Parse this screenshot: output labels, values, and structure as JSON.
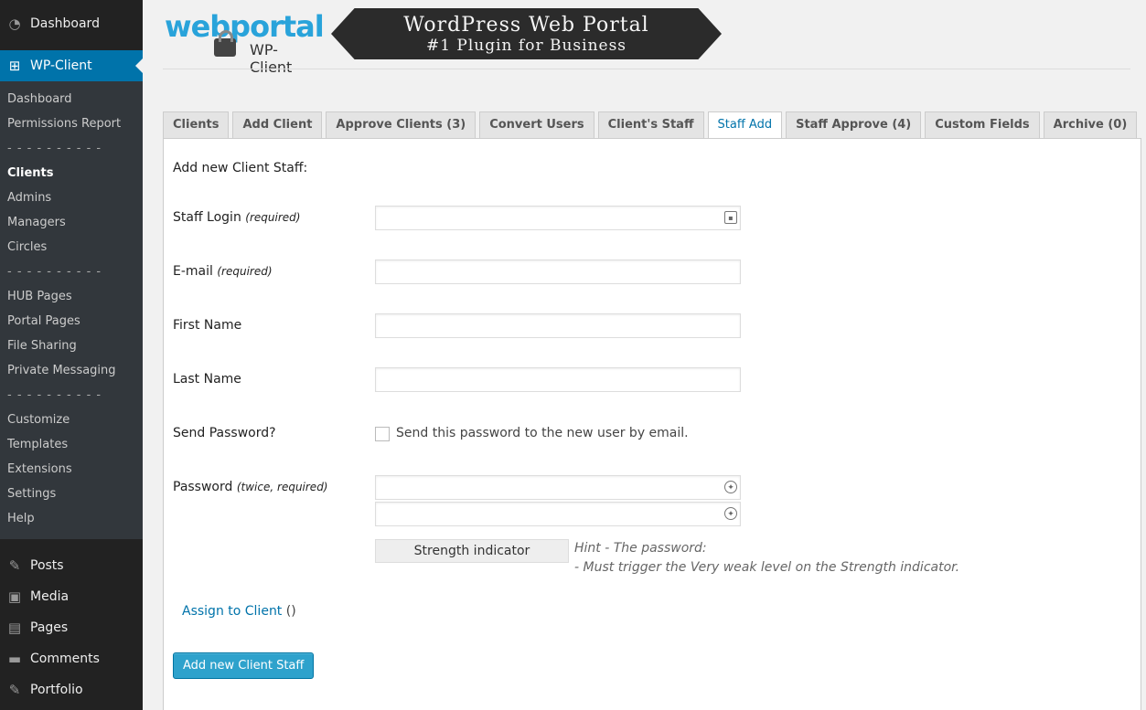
{
  "sidebar": {
    "dashboard": "Dashboard",
    "plugin": "WP-Client",
    "submenu": [
      "Dashboard",
      "Permissions Report",
      "- - - - - - - - - -",
      "Clients",
      "Admins",
      "Managers",
      "Circles",
      "- - - - - - - - - -",
      "HUB Pages",
      "Portal Pages",
      "File Sharing",
      "Private Messaging",
      "- - - - - - - - - -",
      "Customize",
      "Templates",
      "Extensions",
      "Settings",
      "Help"
    ],
    "current_submenu": "Clients",
    "bottom": [
      "Posts",
      "Media",
      "Pages",
      "Comments",
      "Portfolio"
    ]
  },
  "header": {
    "logo_brand": "webportal",
    "logo_sub": "WP-Client",
    "banner_line1": "WordPress Web Portal",
    "banner_line2": "#1 Plugin for Business"
  },
  "tabs": [
    "Clients",
    "Add Client",
    "Approve Clients (3)",
    "Convert Users",
    "Client's Staff",
    "Staff Add",
    "Staff Approve (4)",
    "Custom Fields",
    "Archive (0)"
  ],
  "active_tab": "Staff Add",
  "form": {
    "title": "Add new Client Staff:",
    "staff_login": {
      "label": "Staff Login",
      "note": "(required)",
      "value": ""
    },
    "email": {
      "label": "E-mail",
      "note": "(required)",
      "value": ""
    },
    "first_name": {
      "label": "First Name",
      "value": ""
    },
    "last_name": {
      "label": "Last Name",
      "value": ""
    },
    "send_password": {
      "label": "Send Password?",
      "checkbox_text": "Send this password to the new user by email.",
      "checked": false
    },
    "password": {
      "label": "Password",
      "note": "(twice, required)",
      "value1": "",
      "value2": ""
    },
    "strength_indicator": "Strength indicator",
    "hint_line1": "Hint - The password:",
    "hint_line2": "- Must trigger the Very weak level on the Strength indicator.",
    "assign_link": "Assign to Client",
    "assign_count": "()",
    "submit_label": "Add new Client Staff"
  },
  "colors": {
    "sidebar_bg": "#222222",
    "submenu_bg": "#32373c",
    "accent": "#0073aa",
    "button": "#2ea2cc"
  }
}
